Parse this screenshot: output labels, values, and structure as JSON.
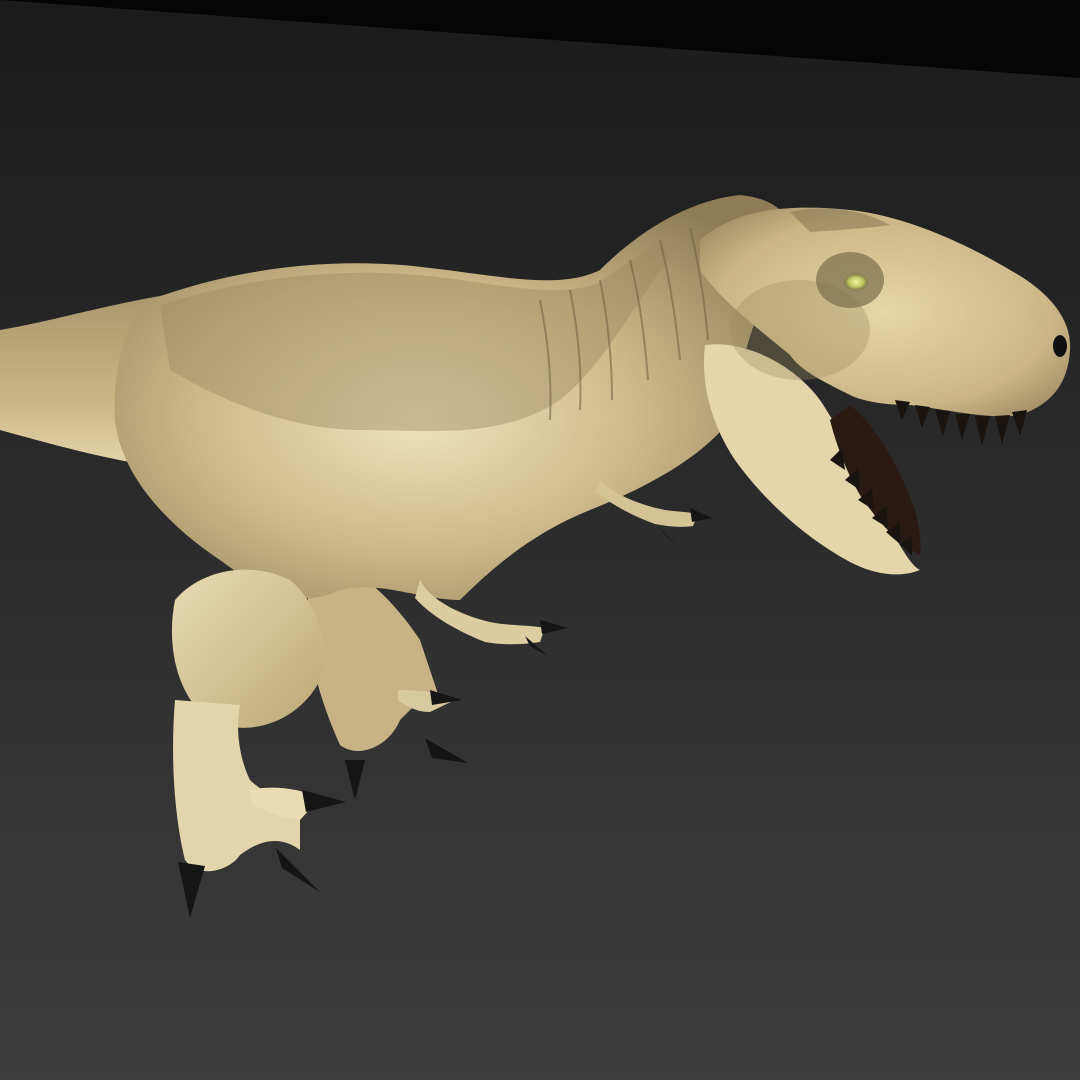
{
  "scene": {
    "subject": "tyrannosaurus-rex-3d-render",
    "colors": {
      "backdrop_top": "#1f1f1f",
      "backdrop_bottom": "#3c3c3c",
      "band": "#050505",
      "skin_light": "#efe2b8",
      "skin_mid": "#c9b484",
      "skin_dark": "#8c7a55",
      "claw": "#151515",
      "eye": "#d8e07a",
      "mouth": "#2a1a14"
    }
  }
}
